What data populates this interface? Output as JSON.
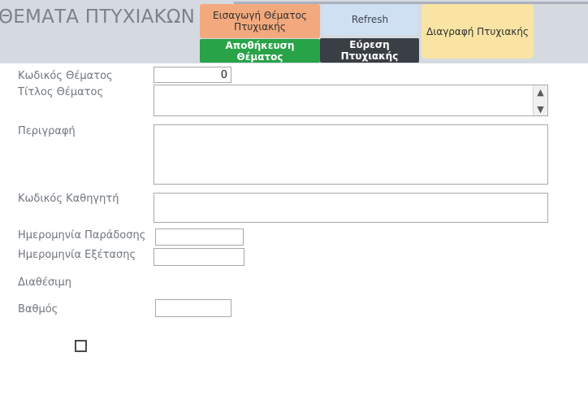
{
  "header": {
    "title": "ΘΕΜΑΤΑ ΠΤΥΧΙΑΚΩΝ",
    "buttons": {
      "insert": "Εισαγωγή Θέματος Πτυχιακής",
      "save": "Αποθήκευση Θέματος",
      "refresh": "Refresh",
      "find": "Εύρεση Πτυχιακής",
      "delete": "Διαγραφή Πτυχιακής"
    },
    "colors": {
      "bar_background": "#d5dae1",
      "title_text": "#7b8289",
      "insert": "#f2a97e",
      "save": "#29a348",
      "refresh": "#cfe0f2",
      "find": "#3a3f46",
      "delete": "#f9e4a4"
    }
  },
  "form": {
    "fields": {
      "code": {
        "label": "Κωδικός Θέματος",
        "value": "0",
        "placeholder": ""
      },
      "title": {
        "label": "Τίτλος Θέματος",
        "value": "",
        "placeholder": ""
      },
      "description": {
        "label": "Περιγραφή",
        "value": "",
        "placeholder": ""
      },
      "professor_code": {
        "label": "Κωδικός Καθηγητή",
        "value": "",
        "placeholder": ""
      },
      "delivery_date": {
        "label": "Ημερομηνία Παράδοσης",
        "value": "",
        "placeholder": ""
      },
      "exam_date": {
        "label": "Ημερομηνία Εξέτασης",
        "value": "",
        "placeholder": ""
      },
      "available": {
        "label": "Διαθέσιμη",
        "checked": false
      },
      "grade": {
        "label": "Βαθμός",
        "value": "",
        "placeholder": ""
      }
    },
    "scrollbar": {
      "up_icon": "▲",
      "down_icon": "▼"
    }
  }
}
